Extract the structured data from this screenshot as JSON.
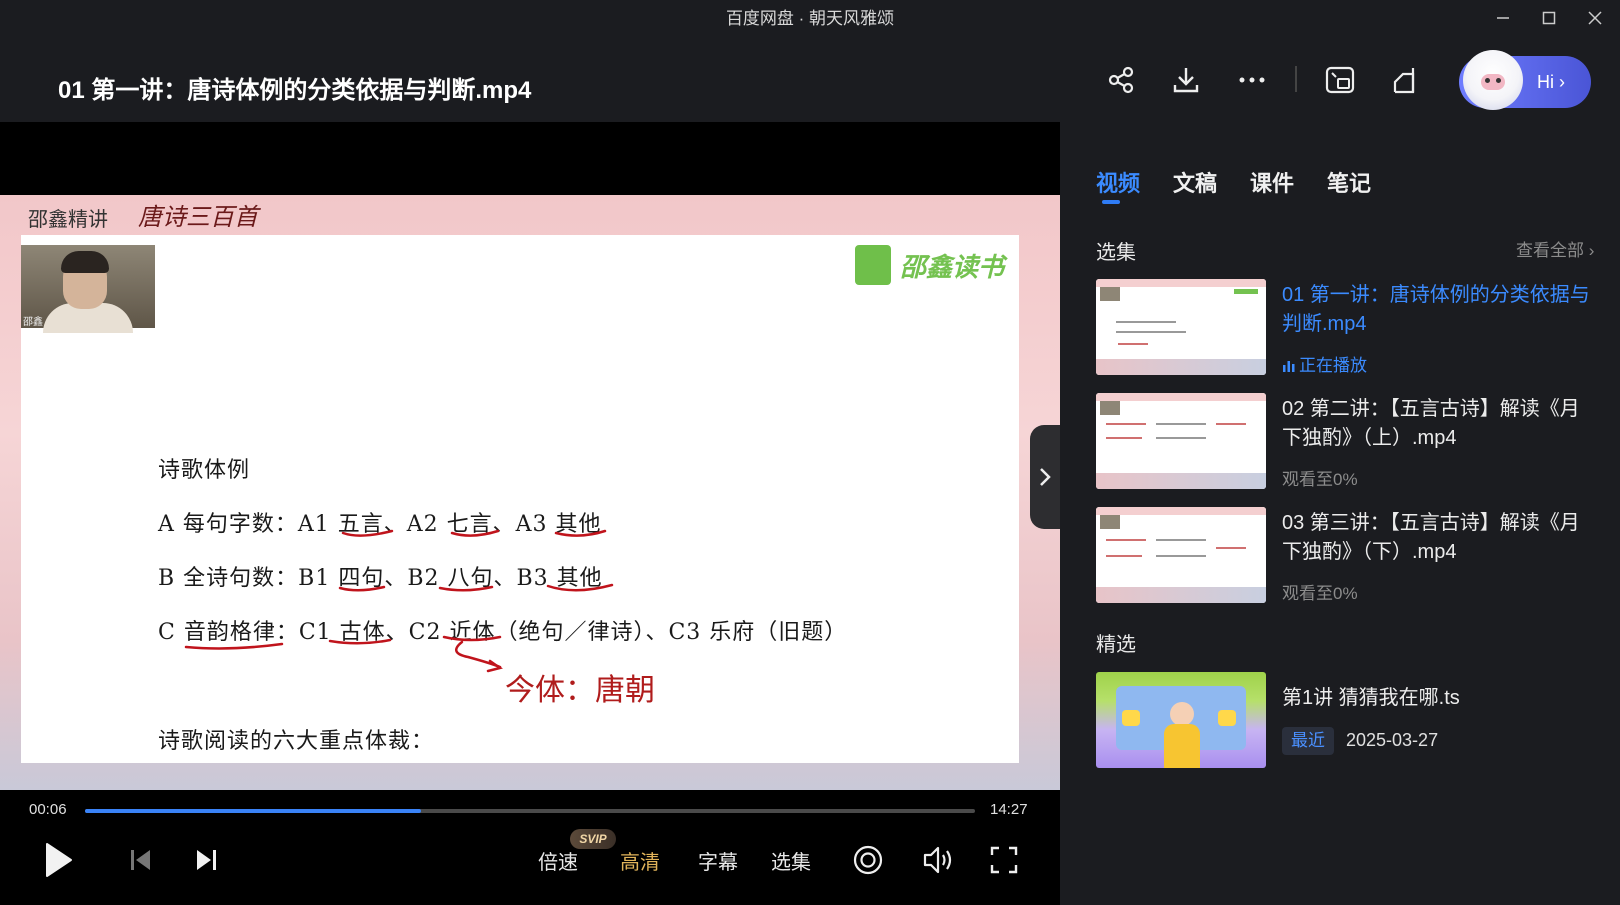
{
  "window": {
    "app_title": "百度网盘 · 朝天风雅颂"
  },
  "header": {
    "file_title": "01 第一讲：唐诗体例的分类依据与判断.mp4",
    "hi_label": "Hi ›"
  },
  "slide": {
    "header_text": "邵鑫精讲",
    "header_script": "唐诗三百首",
    "brand": "邵鑫读书",
    "teacher_label": "邵鑫",
    "lines": [
      "诗歌体例",
      "A 每句字数：A1 五言、A2 七言、A3 其他",
      "B 全诗句数：B1 四句、B2 八句、B3 其他",
      "C 音韵格律：C1 古体、C2 近体（绝句／律诗）、C3 乐府（旧题）",
      "诗歌阅读的六大重点体裁："
    ],
    "annotation": "今体：唐朝"
  },
  "player": {
    "current_time": "00:06",
    "total_time": "14:27",
    "progress_fraction": 0.378,
    "speed_label": "倍速",
    "svip_badge": "SVIP",
    "quality_label": "高清",
    "subtitle_label": "字幕",
    "episodes_label": "选集"
  },
  "panel": {
    "tabs": [
      "视频",
      "文稿",
      "课件",
      "笔记"
    ],
    "active_tab": "视频",
    "section_episodes": "选集",
    "view_all": "查看全部 ›",
    "episodes": [
      {
        "title": "01 第一讲：唐诗体例的分类依据与判断.mp4",
        "status": "正在播放",
        "active": true
      },
      {
        "title": "02 第二讲：【五言古诗】解读《月下独酌》（上）.mp4",
        "status": "观看至0%",
        "active": false
      },
      {
        "title": "03 第三讲：【五言古诗】解读《月下独酌》（下）.mp4",
        "status": "观看至0%",
        "active": false
      }
    ],
    "section_featured": "精选",
    "featured": {
      "title": "第1讲 猜猜我在哪.ts",
      "badge": "最近",
      "date": "2025-03-27"
    }
  },
  "colors": {
    "accent": "#3b8bff",
    "progress": "#3a83f7",
    "quality_gold": "#e2b45a",
    "annotation_red": "#b01c1c"
  },
  "icons": [
    "share-icon",
    "download-icon",
    "more-icon",
    "picture-in-picture-icon",
    "window-mode-icon",
    "play-icon",
    "previous-icon",
    "next-icon",
    "screenshot-icon",
    "volume-icon",
    "fullscreen-icon"
  ]
}
